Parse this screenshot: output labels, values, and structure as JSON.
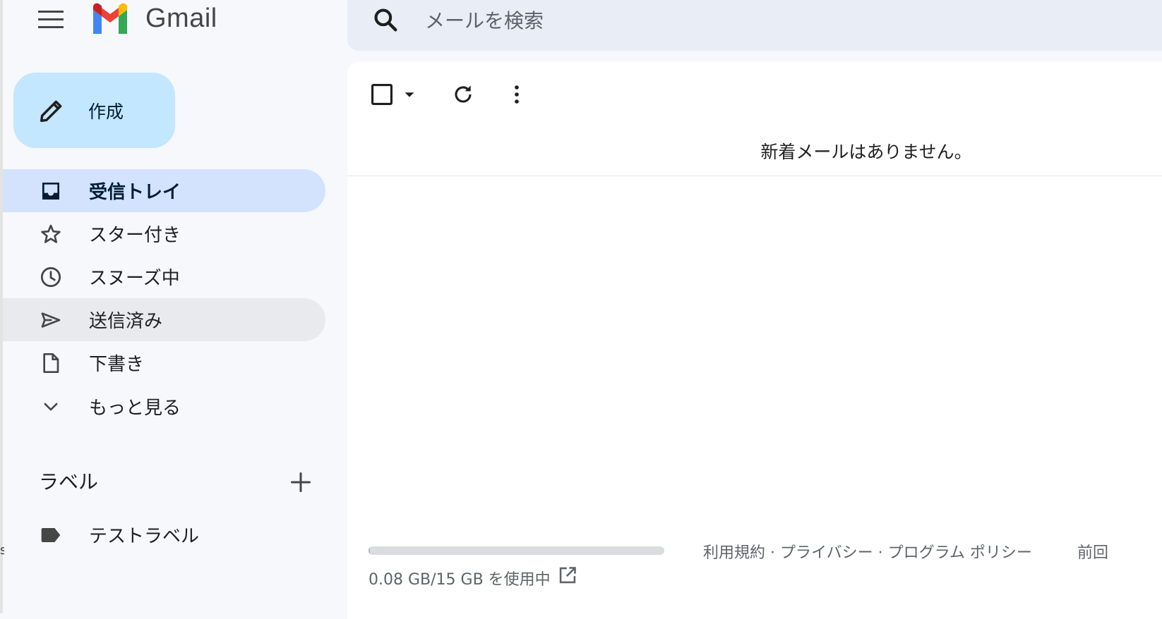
{
  "app": {
    "name": "Gmail"
  },
  "search": {
    "placeholder": "メールを検索"
  },
  "compose": {
    "label": "作成"
  },
  "nav": {
    "items": [
      {
        "label": "受信トレイ",
        "icon": "inbox-icon",
        "state": "active"
      },
      {
        "label": "スター付き",
        "icon": "star-icon"
      },
      {
        "label": "スヌーズ中",
        "icon": "clock-icon"
      },
      {
        "label": "送信済み",
        "icon": "send-icon",
        "state": "hover"
      },
      {
        "label": "下書き",
        "icon": "draft-icon"
      },
      {
        "label": "もっと見る",
        "icon": "chevron-down-icon"
      }
    ]
  },
  "labels": {
    "heading": "ラベル",
    "items": [
      {
        "label": "テストラベル",
        "icon": "label-icon"
      }
    ]
  },
  "toolbar": {
    "icons": [
      "checkbox-icon",
      "dropdown-arrow-icon",
      "refresh-icon",
      "more-vert-icon"
    ]
  },
  "main": {
    "empty_message": "新着メールはありません。"
  },
  "footer": {
    "storage_text": "0.08 GB/15 GB を使用中",
    "storage_used_fraction": 0.0053,
    "links": [
      "利用規約",
      "プライバシー",
      "プログラム ポリシー"
    ],
    "separator": "·",
    "last_activity": "前回"
  },
  "colors": {
    "background": "#f6f8fc",
    "compose_bg": "#c2e7ff",
    "active_nav_bg": "#d3e3fd",
    "search_bg": "#e9eef6"
  }
}
